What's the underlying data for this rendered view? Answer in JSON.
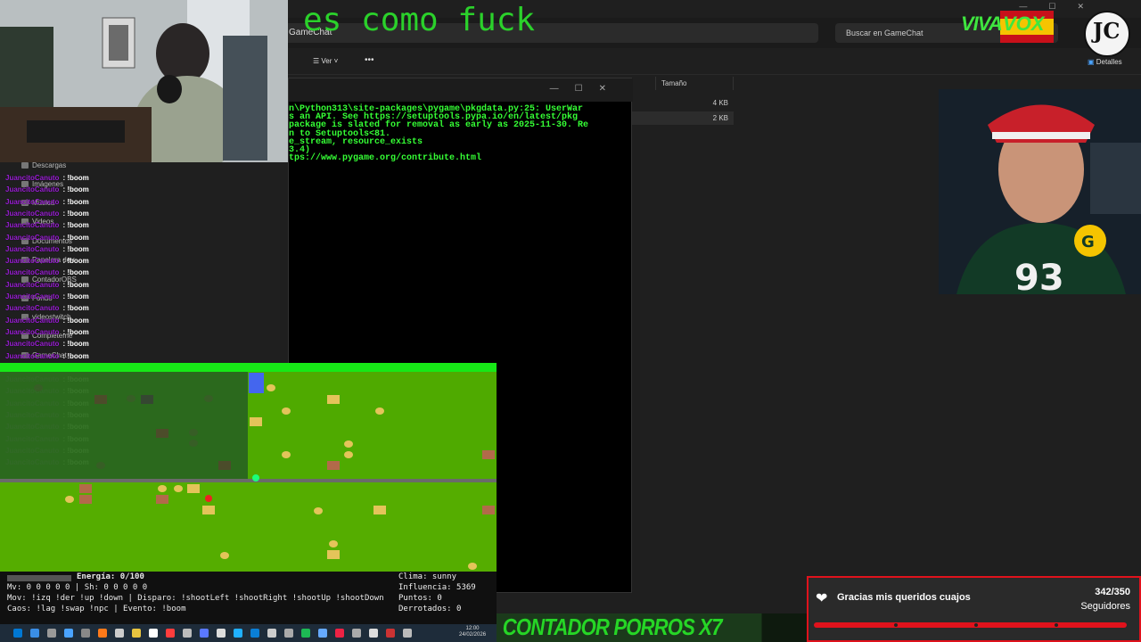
{
  "overlay_title": "es como fuck",
  "explorer": {
    "path_text": "GameChat",
    "search_placeholder": "Buscar en GameChat",
    "view_label": "Ver",
    "more_label": "•••",
    "details_label": "Detalles",
    "column_size": "Tamaño",
    "rows": [
      {
        "size": "4 KB"
      },
      {
        "size": "2 KB"
      }
    ],
    "nav_items": [
      "Descargas",
      "Imágenes",
      "Música",
      "Videos",
      "Documentos",
      "Papelera de r",
      "ContadorOBS",
      "Fondo",
      "videostwitch",
      "Completeme",
      "GameChat"
    ]
  },
  "terminal": {
    "lines": [
      "n\\Python313\\site-packages\\pygame\\pkgdata.py:25: UserWar",
      "s an API. See https://setuptools.pypa.io/en/latest/pkg",
      "package is slated for removal as early as 2025-11-30. Re",
      "n to Setuptools<81.",
      "e_stream, resource_exists",
      "3.4)",
      "tps://www.pygame.org/contribute.html"
    ]
  },
  "chat": {
    "username": "JuancitoCanuto",
    "message": ": !boom",
    "count": 25
  },
  "game_hud": {
    "energy": "Energía: 0/100",
    "mv_sh": "Mv: 0 0 0 0 0  |  Sh: 0 0 0 0 0",
    "mov": "Mov: !izq !der !up !down  |  Disparo: !shootLeft !shootRight !shootUp !shootDown",
    "caos": "Caos: !lag !swap !npc  |  Evento: !boom",
    "clima": "Clima: sunny",
    "influencia": "Influencia: 5369",
    "puntos": "Puntos: 0",
    "derrotados": "Derrotados: 0"
  },
  "taskbar": {
    "time": "12:00",
    "date": "24/02/2026"
  },
  "counter_banner": "CONTADOR PORROS X7",
  "follower_goal": {
    "text": "Gracias mis queridos cuajos",
    "count": "342/350",
    "label": "Seguidores",
    "progress": 0.977
  },
  "logo": {
    "viva": "VIVA",
    "vox": "VOX",
    "jc": "JC"
  },
  "colors": {
    "terminal_green": "#35ff35",
    "game_grass": "#55ad00",
    "goal_red": "#e0121c",
    "chat_user": "#9a1fd4"
  }
}
